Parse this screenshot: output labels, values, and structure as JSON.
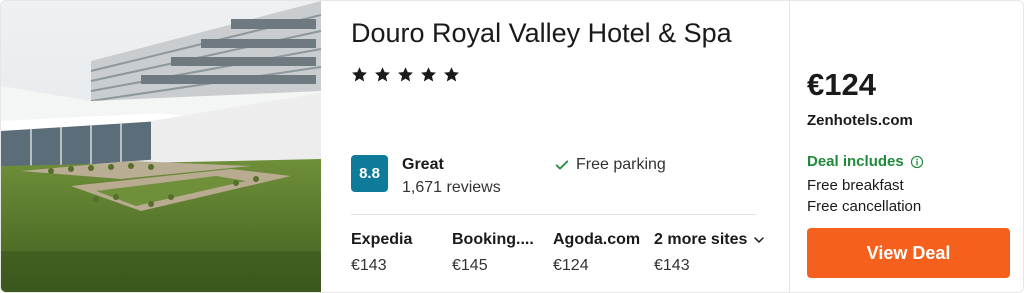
{
  "hotel": {
    "name": "Douro Royal Valley Hotel & Spa",
    "stars": 5,
    "rating_score": "8.8",
    "rating_label": "Great",
    "reviews": "1,671 reviews",
    "amenity": "Free parking"
  },
  "offers": [
    {
      "site": "Expedia",
      "price": "€143"
    },
    {
      "site": "Booking....",
      "price": "€145"
    },
    {
      "site": "Agoda.com",
      "price": "€124"
    },
    {
      "site": "2 more sites",
      "price": "€143"
    }
  ],
  "best_deal": {
    "price": "€124",
    "provider": "Zenhotels.com",
    "includes_label": "Deal includes",
    "includes": [
      "Free breakfast",
      "Free cancellation"
    ],
    "button_label": "View Deal"
  },
  "colors": {
    "score_badge": "#0e7b9a",
    "deal_green": "#1f8a3a",
    "cta_orange": "#f5611c"
  }
}
